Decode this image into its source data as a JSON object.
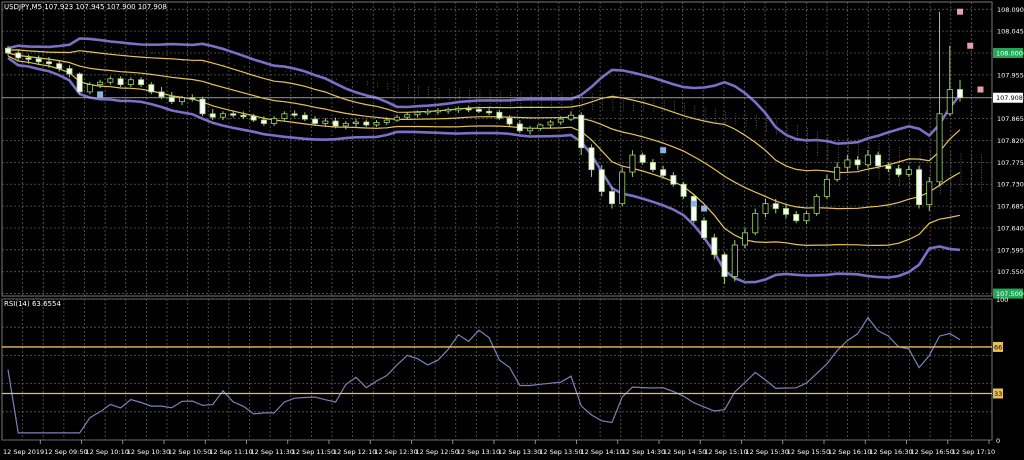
{
  "chart_data": {
    "type": "candlestick",
    "symbol_info": "USDJPY,M5  107.923 107.945 107.900 107.908",
    "y_ticks": [
      "108.090",
      "108.045",
      "108.000",
      "107.955",
      "107.908",
      "107.865",
      "107.820",
      "107.775",
      "107.730",
      "107.685",
      "107.640",
      "107.595",
      "107.550",
      "107.500"
    ],
    "y_tick_values": [
      108.09,
      108.045,
      108.0,
      107.955,
      107.908,
      107.865,
      107.82,
      107.775,
      107.73,
      107.685,
      107.64,
      107.595,
      107.55,
      107.505
    ],
    "price_ylim": [
      107.5,
      108.105
    ],
    "highlight_labels": [
      {
        "text": "108.000",
        "value": 108.0,
        "color": "#26a65b"
      },
      {
        "text": "107.908",
        "value": 107.908,
        "color": "#ffffff"
      },
      {
        "text": "107.500",
        "value": 107.505,
        "color": "#26a65b"
      }
    ],
    "x_ticks": [
      "12 Sep 2019",
      "12 Sep 09:50",
      "12 Sep 10:10",
      "12 Sep 10:30",
      "12 Sep 10:50",
      "12 Sep 11:10",
      "12 Sep 11:30",
      "12 Sep 11:50",
      "12 Sep 12:10",
      "12 Sep 12:30",
      "12 Sep 12:50",
      "12 Sep 13:10",
      "12 Sep 13:30",
      "12 Sep 13:50",
      "12 Sep 14:10",
      "12 Sep 14:30",
      "12 Sep 14:50",
      "12 Sep 15:10",
      "12 Sep 15:30",
      "12 Sep 15:50",
      "12 Sep 16:10",
      "12 Sep 16:30",
      "12 Sep 16:50",
      "12 Sep 17:10"
    ],
    "candles": [
      [
        108.01,
        108.015,
        107.995,
        108.0
      ],
      [
        108.0,
        108.005,
        107.985,
        107.99
      ],
      [
        107.99,
        107.997,
        107.978,
        107.988
      ],
      [
        107.988,
        107.995,
        107.975,
        107.982
      ],
      [
        107.982,
        107.992,
        107.97,
        107.978
      ],
      [
        107.978,
        107.985,
        107.962,
        107.968
      ],
      [
        107.968,
        107.975,
        107.95,
        107.957
      ],
      [
        107.957,
        107.96,
        107.915,
        107.92
      ],
      [
        107.92,
        107.94,
        107.915,
        107.935
      ],
      [
        107.935,
        107.945,
        107.928,
        107.94
      ],
      [
        107.94,
        107.952,
        107.935,
        107.947
      ],
      [
        107.947,
        107.952,
        107.93,
        107.935
      ],
      [
        107.935,
        107.95,
        107.93,
        107.945
      ],
      [
        107.945,
        107.95,
        107.93,
        107.935
      ],
      [
        107.935,
        107.94,
        107.915,
        107.92
      ],
      [
        107.92,
        107.93,
        107.905,
        107.91
      ],
      [
        107.91,
        107.92,
        107.895,
        107.9
      ],
      [
        107.9,
        107.912,
        107.893,
        107.908
      ],
      [
        107.908,
        107.915,
        107.9,
        107.905
      ],
      [
        107.905,
        107.91,
        107.87,
        107.875
      ],
      [
        107.875,
        107.885,
        107.862,
        107.868
      ],
      [
        107.868,
        107.88,
        107.862,
        107.875
      ],
      [
        107.875,
        107.882,
        107.867,
        107.872
      ],
      [
        107.872,
        107.88,
        107.864,
        107.87
      ],
      [
        107.87,
        107.875,
        107.858,
        107.862
      ],
      [
        107.862,
        107.87,
        107.85,
        107.855
      ],
      [
        107.855,
        107.87,
        107.85,
        107.865
      ],
      [
        107.865,
        107.88,
        107.86,
        107.875
      ],
      [
        107.875,
        107.882,
        107.868,
        107.872
      ],
      [
        107.872,
        107.878,
        107.86,
        107.864
      ],
      [
        107.864,
        107.87,
        107.85,
        107.855
      ],
      [
        107.855,
        107.866,
        107.848,
        107.86
      ],
      [
        107.86,
        107.867,
        107.845,
        107.85
      ],
      [
        107.85,
        107.86,
        107.843,
        107.855
      ],
      [
        107.855,
        107.865,
        107.848,
        107.858
      ],
      [
        107.858,
        107.863,
        107.848,
        107.852
      ],
      [
        107.852,
        107.862,
        107.848,
        107.857
      ],
      [
        107.857,
        107.868,
        107.852,
        107.862
      ],
      [
        107.862,
        107.873,
        107.858,
        107.868
      ],
      [
        107.868,
        107.878,
        107.862,
        107.873
      ],
      [
        107.873,
        107.882,
        107.867,
        107.878
      ],
      [
        107.878,
        107.885,
        107.872,
        107.88
      ],
      [
        107.88,
        107.887,
        107.873,
        107.882
      ],
      [
        107.882,
        107.888,
        107.875,
        107.884
      ],
      [
        107.884,
        107.89,
        107.877,
        107.886
      ],
      [
        107.886,
        107.892,
        107.878,
        107.884
      ],
      [
        107.884,
        107.89,
        107.876,
        107.88
      ],
      [
        107.88,
        107.886,
        107.872,
        107.878
      ],
      [
        107.878,
        107.883,
        107.862,
        107.866
      ],
      [
        107.866,
        107.872,
        107.85,
        107.854
      ],
      [
        107.854,
        107.862,
        107.835,
        107.84
      ],
      [
        107.84,
        107.85,
        107.832,
        107.845
      ],
      [
        107.845,
        107.855,
        107.84,
        107.852
      ],
      [
        107.852,
        107.862,
        107.846,
        107.858
      ],
      [
        107.858,
        107.87,
        107.852,
        107.864
      ],
      [
        107.864,
        107.88,
        107.86,
        107.872
      ],
      [
        107.872,
        107.878,
        107.79,
        107.805
      ],
      [
        107.805,
        107.812,
        107.745,
        107.76
      ],
      [
        107.76,
        107.77,
        107.705,
        107.715
      ],
      [
        107.715,
        107.725,
        107.68,
        107.69
      ],
      [
        107.69,
        107.765,
        107.685,
        107.755
      ],
      [
        107.755,
        107.8,
        107.745,
        107.79
      ],
      [
        107.79,
        107.795,
        107.77,
        107.775
      ],
      [
        107.775,
        107.782,
        107.755,
        107.76
      ],
      [
        107.76,
        107.768,
        107.742,
        107.748
      ],
      [
        107.748,
        107.755,
        107.725,
        107.73
      ],
      [
        107.73,
        107.735,
        107.7,
        107.705
      ],
      [
        107.705,
        107.71,
        107.65,
        107.655
      ],
      [
        107.655,
        107.662,
        107.615,
        107.62
      ],
      [
        107.62,
        107.628,
        107.575,
        107.585
      ],
      [
        107.585,
        107.59,
        107.525,
        107.54
      ],
      [
        107.54,
        107.615,
        107.53,
        107.605
      ],
      [
        107.605,
        107.64,
        107.598,
        107.63
      ],
      [
        107.63,
        107.68,
        107.625,
        107.67
      ],
      [
        107.67,
        107.7,
        107.662,
        107.69
      ],
      [
        107.69,
        107.7,
        107.67,
        107.68
      ],
      [
        107.68,
        107.69,
        107.66,
        107.668
      ],
      [
        107.668,
        107.675,
        107.65,
        107.655
      ],
      [
        107.655,
        107.675,
        107.648,
        107.67
      ],
      [
        107.67,
        107.71,
        107.665,
        107.705
      ],
      [
        107.705,
        107.75,
        107.7,
        107.74
      ],
      [
        107.74,
        107.775,
        107.735,
        107.765
      ],
      [
        107.765,
        107.79,
        107.755,
        107.78
      ],
      [
        107.78,
        107.788,
        107.76,
        107.77
      ],
      [
        107.77,
        107.8,
        107.765,
        107.79
      ],
      [
        107.79,
        107.797,
        107.762,
        107.768
      ],
      [
        107.768,
        107.775,
        107.755,
        107.762
      ],
      [
        107.762,
        107.77,
        107.745,
        107.75
      ],
      [
        107.75,
        107.768,
        107.745,
        107.76
      ],
      [
        107.76,
        107.768,
        107.68,
        107.688
      ],
      [
        107.688,
        107.745,
        107.675,
        107.735
      ],
      [
        107.735,
        108.085,
        107.725,
        107.875
      ],
      [
        107.875,
        108.015,
        107.87,
        107.925
      ],
      [
        107.925,
        107.945,
        107.9,
        107.908
      ]
    ]
  }
}
